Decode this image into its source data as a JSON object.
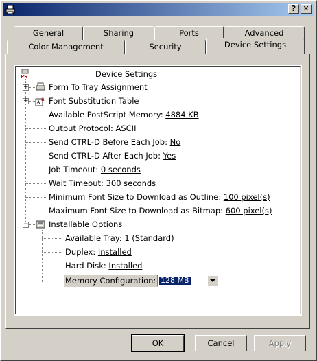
{
  "title_bar": {
    "help_button": "?",
    "close_button": "✕"
  },
  "tabs": [
    {
      "label": "General"
    },
    {
      "label": "Sharing"
    },
    {
      "label": "Ports"
    },
    {
      "label": "Advanced"
    },
    {
      "label": "Color Management"
    },
    {
      "label": "Security"
    },
    {
      "label": "Device Settings",
      "active": true
    }
  ],
  "tree": {
    "root": {
      "label": "Device Settings",
      "icon": "printer-ps-icon"
    },
    "items": [
      {
        "label": "Form To Tray Assignment",
        "icon": "tray-icon"
      },
      {
        "label": "Font Substitution Table",
        "icon": "font-icon"
      },
      {
        "label": "Available PostScript Memory: ",
        "value": "4884 KB"
      },
      {
        "label": "Output Protocol: ",
        "value": "ASCII"
      },
      {
        "label": "Send CTRL-D Before Each Job: ",
        "value": "No"
      },
      {
        "label": "Send CTRL-D After Each Job: ",
        "value": "Yes"
      },
      {
        "label": "Job Timeout: ",
        "value": "0 seconds"
      },
      {
        "label": "Wait Timeout: ",
        "value": "300 seconds"
      },
      {
        "label": "Minimum Font Size to Download as Outline: ",
        "value": "100 pixel(s)"
      },
      {
        "label": "Maximum Font Size to Download as Bitmap: ",
        "value": "600 pixel(s)"
      },
      {
        "label": "Installable Options",
        "icon": "options-icon"
      }
    ],
    "options": [
      {
        "label": "Available Tray: ",
        "value": "1 (Standard)"
      },
      {
        "label": "Duplex: ",
        "value": "Installed"
      },
      {
        "label": "Hard Disk: ",
        "value": "Installed"
      }
    ],
    "memory": {
      "label": "Memory Configuration:",
      "value": "128 MB"
    }
  },
  "buttons": {
    "ok": "OK",
    "cancel": "Cancel",
    "apply": "Apply"
  }
}
